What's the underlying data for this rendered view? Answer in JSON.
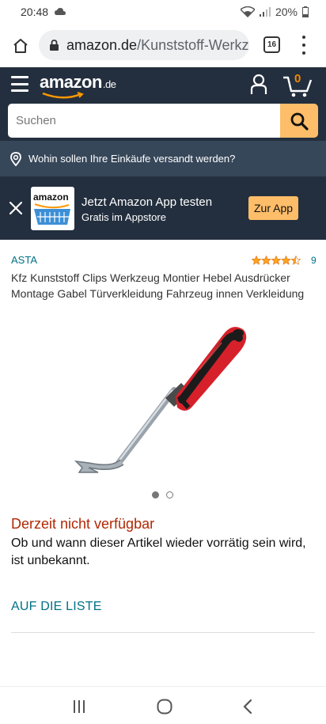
{
  "status_bar": {
    "time": "20:48",
    "battery": "20%"
  },
  "browser": {
    "url_domain": "amazon.de",
    "url_path": "/Kunststoff-Werkzeug",
    "tab_count": "16"
  },
  "header": {
    "logo_text": "amazon",
    "logo_suffix": ".de",
    "cart_count": "0"
  },
  "search": {
    "placeholder": "Suchen"
  },
  "delivery": {
    "text": "Wohin sollen Ihre Einkäufe versandt werden?"
  },
  "app_banner": {
    "logo_word": "amazon",
    "title": "Jetzt Amazon App testen",
    "subtitle": "Gratis im Appstore",
    "button_label": "Zur App"
  },
  "product": {
    "brand": "ASTA",
    "rating_stars": 4.5,
    "rating_count": "9",
    "title": "Kfz Kunststoff Clips Werkzeug Montier Hebel Ausdrücker Montage Gabel Türverkleidung Fahrzeug innen Verkleidung",
    "image_count": 2,
    "active_image": 1,
    "availability": "Derzeit nicht verfügbar",
    "availability_desc": "Ob und wann dieser Artikel wieder vorrätig sein wird, ist unbekannt.",
    "list_button": "AUF DIE LISTE"
  },
  "colors": {
    "header_bg": "#232f3e",
    "nav_secondary_bg": "#37475a",
    "accent_orange": "#febd69",
    "link_teal": "#007185",
    "unavailable_red": "#b12704",
    "star_color": "#ffa41c"
  },
  "icons": {
    "home": "home-icon",
    "lock": "lock-icon",
    "menu": "hamburger-icon",
    "account": "account-icon",
    "cart": "cart-icon",
    "search": "search-icon",
    "location": "location-pin-icon",
    "close": "close-icon"
  }
}
